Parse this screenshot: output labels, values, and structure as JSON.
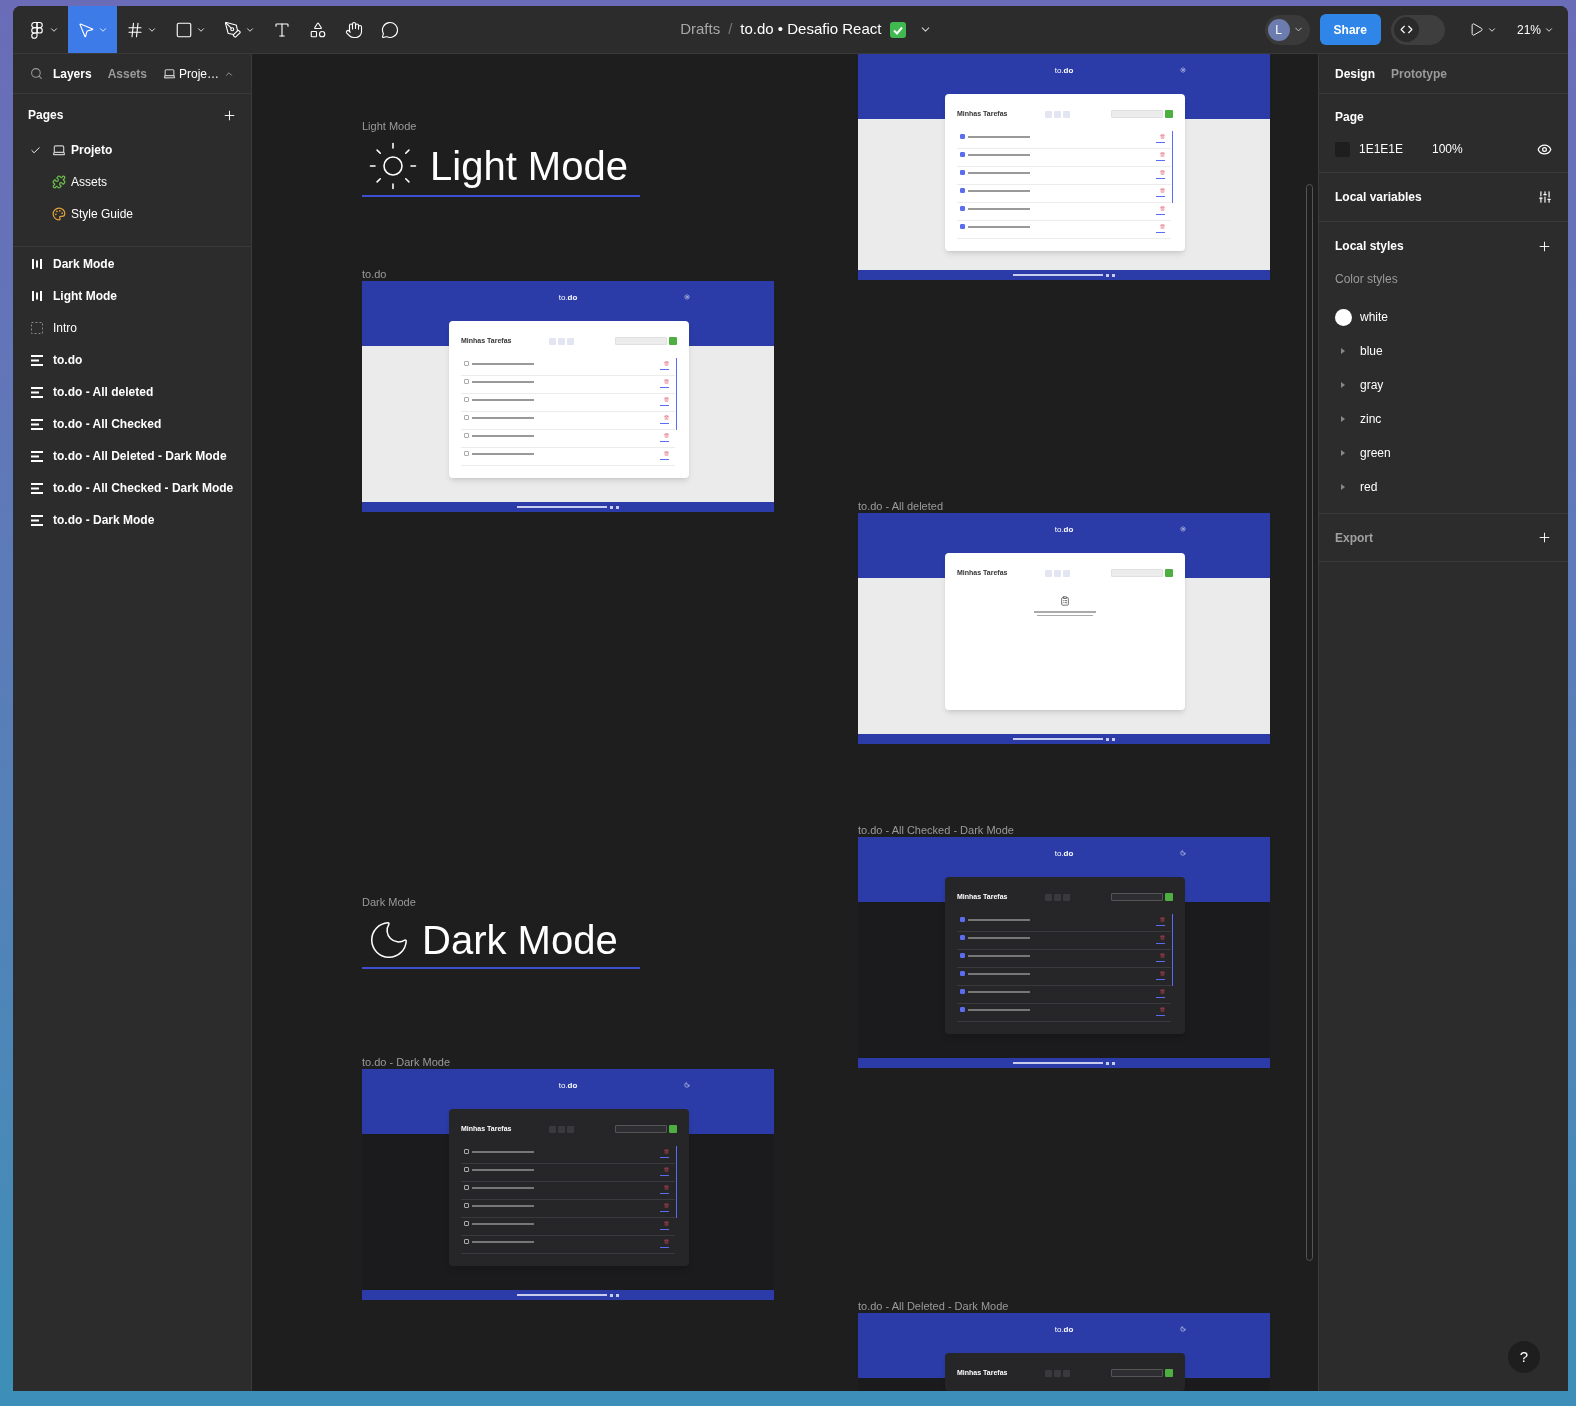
{
  "toolbar": {
    "tools": [
      {
        "kind": "main_menu",
        "selected": false,
        "dropdown": true
      },
      {
        "kind": "move",
        "selected": true,
        "dropdown": true
      },
      {
        "kind": "frame",
        "selected": false,
        "dropdown": true
      },
      {
        "kind": "shape",
        "selected": false,
        "dropdown": true
      },
      {
        "kind": "pen",
        "selected": false,
        "dropdown": true
      },
      {
        "kind": "text",
        "selected": false,
        "dropdown": false
      },
      {
        "kind": "resources",
        "selected": false,
        "dropdown": false
      },
      {
        "kind": "hand",
        "selected": false,
        "dropdown": false
      },
      {
        "kind": "comment",
        "selected": false,
        "dropdown": false
      }
    ],
    "folder": "Drafts",
    "separator": "/",
    "file_title": "to.do • Desafio React",
    "avatar_initial": "L",
    "share_label": "Share",
    "dev_mode": {
      "on": false
    },
    "zoom": "21%"
  },
  "left_panel": {
    "tabs": [
      {
        "label": "Layers",
        "selected": true
      },
      {
        "label": "Assets",
        "selected": false
      }
    ],
    "page_menu": "Proje…",
    "pages_title": "Pages",
    "pages": [
      {
        "label": "Projeto",
        "kind": "laptop",
        "selected": true
      },
      {
        "label": "Assets",
        "kind": "puzzle",
        "selected": false
      },
      {
        "label": "Style Guide",
        "kind": "palette",
        "selected": false
      }
    ],
    "layers": [
      {
        "label": "Dark Mode",
        "kind": "section"
      },
      {
        "label": "Light Mode",
        "kind": "section"
      },
      {
        "label": "Intro",
        "kind": "frame"
      },
      {
        "label": "to.do",
        "kind": "autolayout"
      },
      {
        "label": "to.do - All deleted",
        "kind": "autolayout"
      },
      {
        "label": "to.do - All Checked",
        "kind": "autolayout"
      },
      {
        "label": "to.do - All Deleted - Dark Mode",
        "kind": "autolayout"
      },
      {
        "label": "to.do - All Checked - Dark Mode",
        "kind": "autolayout"
      },
      {
        "label": "to.do - Dark Mode",
        "kind": "autolayout"
      }
    ]
  },
  "canvas": {
    "items": [
      {
        "kind": "frame",
        "dark": false,
        "logo": "to.**do**",
        "card_title": "Minhas Tarefas",
        "tasks": [
          {
            "checked": true
          },
          {
            "checked": true
          },
          {
            "checked": true
          },
          {
            "checked": true
          },
          {
            "checked": true
          },
          {
            "checked": true
          }
        ]
      },
      {
        "kind": "heading",
        "label": "Light Mode",
        "title": "Light Mode",
        "dark": false
      },
      {
        "kind": "frame",
        "label": "to.do",
        "dark": false,
        "logo": "to.**do**",
        "card_title": "Minhas Tarefas",
        "tasks": [
          {
            "checked": false
          },
          {
            "checked": false
          },
          {
            "checked": false
          },
          {
            "checked": false
          },
          {
            "checked": false
          },
          {
            "checked": false
          }
        ]
      },
      {
        "kind": "frame",
        "label": "to.do - All deleted",
        "dark": false,
        "logo": "to.**do**",
        "card_title": "Minhas Tarefas"
      },
      {
        "kind": "frame",
        "label": "to.do - All Checked - Dark Mode",
        "dark": true,
        "logo": "to.**do**",
        "card_title": "Minhas Tarefas",
        "tasks": [
          {
            "checked": true
          },
          {
            "checked": true
          },
          {
            "checked": true
          },
          {
            "checked": true
          },
          {
            "checked": true
          },
          {
            "checked": true
          }
        ]
      },
      {
        "kind": "heading",
        "label": "Dark Mode",
        "title": "Dark Mode",
        "dark": true
      },
      {
        "kind": "frame",
        "label": "to.do - Dark Mode",
        "dark": true,
        "logo": "to.**do**",
        "card_title": "Minhas Tarefas",
        "tasks": [
          {
            "checked": false
          },
          {
            "checked": false
          },
          {
            "checked": false
          },
          {
            "checked": false
          },
          {
            "checked": false
          },
          {
            "checked": false
          }
        ]
      },
      {
        "kind": "frame",
        "label": "to.do - All Deleted - Dark Mode",
        "dark": true,
        "logo": "to.**do**",
        "card_title": "Minhas Tarefas"
      }
    ]
  },
  "right_panel": {
    "tabs": [
      {
        "label": "Design",
        "selected": true
      },
      {
        "label": "Prototype",
        "selected": false
      }
    ],
    "page": {
      "title": "Page",
      "color": "#1e1e1e",
      "hex": "1E1E1E",
      "opacity": "100%"
    },
    "local_variables": "Local variables",
    "local_styles": "Local styles",
    "color_styles_title": "Color styles",
    "color_styles": [
      {
        "name": "white",
        "kind": "swatch",
        "color": "#ffffff"
      },
      {
        "name": "blue",
        "kind": "group",
        "expanded": false
      },
      {
        "name": "gray",
        "kind": "group",
        "expanded": false
      },
      {
        "name": "zinc",
        "kind": "group",
        "expanded": false
      },
      {
        "name": "green",
        "kind": "group",
        "expanded": false
      },
      {
        "name": "red",
        "kind": "group",
        "expanded": false
      }
    ],
    "export": "Export"
  },
  "help": "?"
}
